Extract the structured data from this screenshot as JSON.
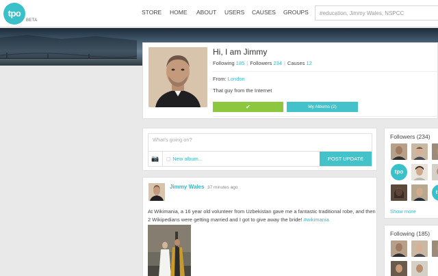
{
  "brand": {
    "logo_text": "tpo",
    "beta_label": "BETA"
  },
  "nav": {
    "items": [
      {
        "label": "STORE"
      },
      {
        "label": "HOME"
      },
      {
        "label": "ABOUT"
      },
      {
        "label": "USERS"
      },
      {
        "label": "CAUSES"
      },
      {
        "label": "GROUPS"
      }
    ],
    "search_placeholder": "#education, Jimmy Wales, NSPCC"
  },
  "profile": {
    "greeting": "Hi, I am Jimmy",
    "following_label": "Following",
    "following_count": "185",
    "followers_label": "Followers",
    "followers_count": "234",
    "causes_label": "Causes",
    "causes_count": "12",
    "from_label": "From:",
    "from_value": "London",
    "bio": "That guy from the Internet",
    "follow_icon": "checkmark-icon",
    "albums_button": "My Albums (2)"
  },
  "composer": {
    "placeholder": "What's going on?",
    "camera_icon": "camera-icon",
    "new_album_label": "New album...",
    "post_button": "POST UPDATE"
  },
  "post": {
    "author": "Jimmy Wales",
    "time": "37 minutes ago",
    "text": "At Wikimania, a 16 year old volunteer from Uzbekistan gave me a fantastic traditional robe, and then 2 Wikipedians were getting married and I got to give away the bride!",
    "hashtag": "#wikimania"
  },
  "sidebar": {
    "followers_title": "Followers (234)",
    "following_title": "Following (185)",
    "show_more": "Show more",
    "tpo_avatar_text": "tpo"
  },
  "colors": {
    "accent": "#43c2c9",
    "green": "#8dc63f",
    "link": "#39b3c0"
  }
}
